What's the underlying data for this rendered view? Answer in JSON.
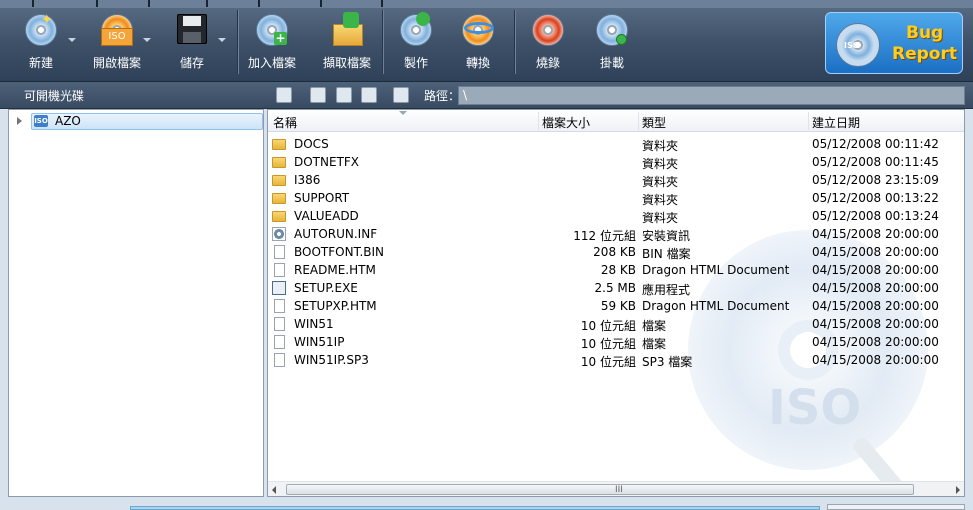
{
  "toolbar": {
    "buttons": [
      {
        "id": "new",
        "label": "新建",
        "icon": "new-disc-icon"
      },
      {
        "id": "open",
        "label": "開啟檔案",
        "icon": "open-iso-icon"
      },
      {
        "id": "save",
        "label": "儲存",
        "icon": "floppy-save-icon"
      },
      {
        "id": "add",
        "label": "加入檔案",
        "icon": "add-file-icon"
      },
      {
        "id": "extract",
        "label": "擷取檔案",
        "icon": "extract-icon"
      },
      {
        "id": "make",
        "label": "製作",
        "icon": "make-disc-icon"
      },
      {
        "id": "convert",
        "label": "轉換",
        "icon": "convert-icon"
      },
      {
        "id": "burn",
        "label": "燒錄",
        "icon": "burn-icon"
      },
      {
        "id": "mount",
        "label": "掛載",
        "icon": "mount-icon"
      }
    ],
    "bug_report": {
      "line1": "Bug",
      "line2": "Report",
      "iso_text": "ISO"
    }
  },
  "subbar": {
    "left_title": "可開機光碟",
    "path_label": "路徑：",
    "path_value": "\\"
  },
  "tree": {
    "items": [
      {
        "label": "AZO",
        "icon_text": "ISO"
      }
    ]
  },
  "list": {
    "columns": {
      "name": "名稱",
      "size": "檔案大小",
      "type": "類型",
      "date": "建立日期"
    },
    "rows": [
      {
        "name": "DOCS",
        "size": "",
        "type": "資料夾",
        "date": "05/12/2008 00:11:42",
        "kind": "folder"
      },
      {
        "name": "DOTNETFX",
        "size": "",
        "type": "資料夾",
        "date": "05/12/2008 00:11:45",
        "kind": "folder"
      },
      {
        "name": "I386",
        "size": "",
        "type": "資料夾",
        "date": "05/12/2008 23:15:09",
        "kind": "folder"
      },
      {
        "name": "SUPPORT",
        "size": "",
        "type": "資料夾",
        "date": "05/12/2008 00:13:22",
        "kind": "folder"
      },
      {
        "name": "VALUEADD",
        "size": "",
        "type": "資料夾",
        "date": "05/12/2008 00:13:24",
        "kind": "folder"
      },
      {
        "name": "AUTORUN.INF",
        "size": "112 位元組",
        "type": "安裝資訊",
        "date": "04/15/2008 20:00:00",
        "kind": "gear"
      },
      {
        "name": "BOOTFONT.BIN",
        "size": "208 KB",
        "type": "BIN 檔案",
        "date": "04/15/2008 20:00:00",
        "kind": "file"
      },
      {
        "name": "README.HTM",
        "size": "28 KB",
        "type": "Dragon HTML Document",
        "date": "04/15/2008 20:00:00",
        "kind": "file"
      },
      {
        "name": "SETUP.EXE",
        "size": "2.5 MB",
        "type": "應用程式",
        "date": "04/15/2008 20:00:00",
        "kind": "exe"
      },
      {
        "name": "SETUPXP.HTM",
        "size": "59 KB",
        "type": "Dragon HTML Document",
        "date": "04/15/2008 20:00:00",
        "kind": "file"
      },
      {
        "name": "WIN51",
        "size": "10 位元組",
        "type": "檔案",
        "date": "04/15/2008 20:00:00",
        "kind": "file"
      },
      {
        "name": "WIN51IP",
        "size": "10 位元組",
        "type": "檔案",
        "date": "04/15/2008 20:00:00",
        "kind": "file"
      },
      {
        "name": "WIN51IP.SP3",
        "size": "10 位元組",
        "type": "SP3 檔案",
        "date": "04/15/2008 20:00:00",
        "kind": "file"
      }
    ],
    "watermark_text": "ISO",
    "scroll_grip": "III"
  }
}
